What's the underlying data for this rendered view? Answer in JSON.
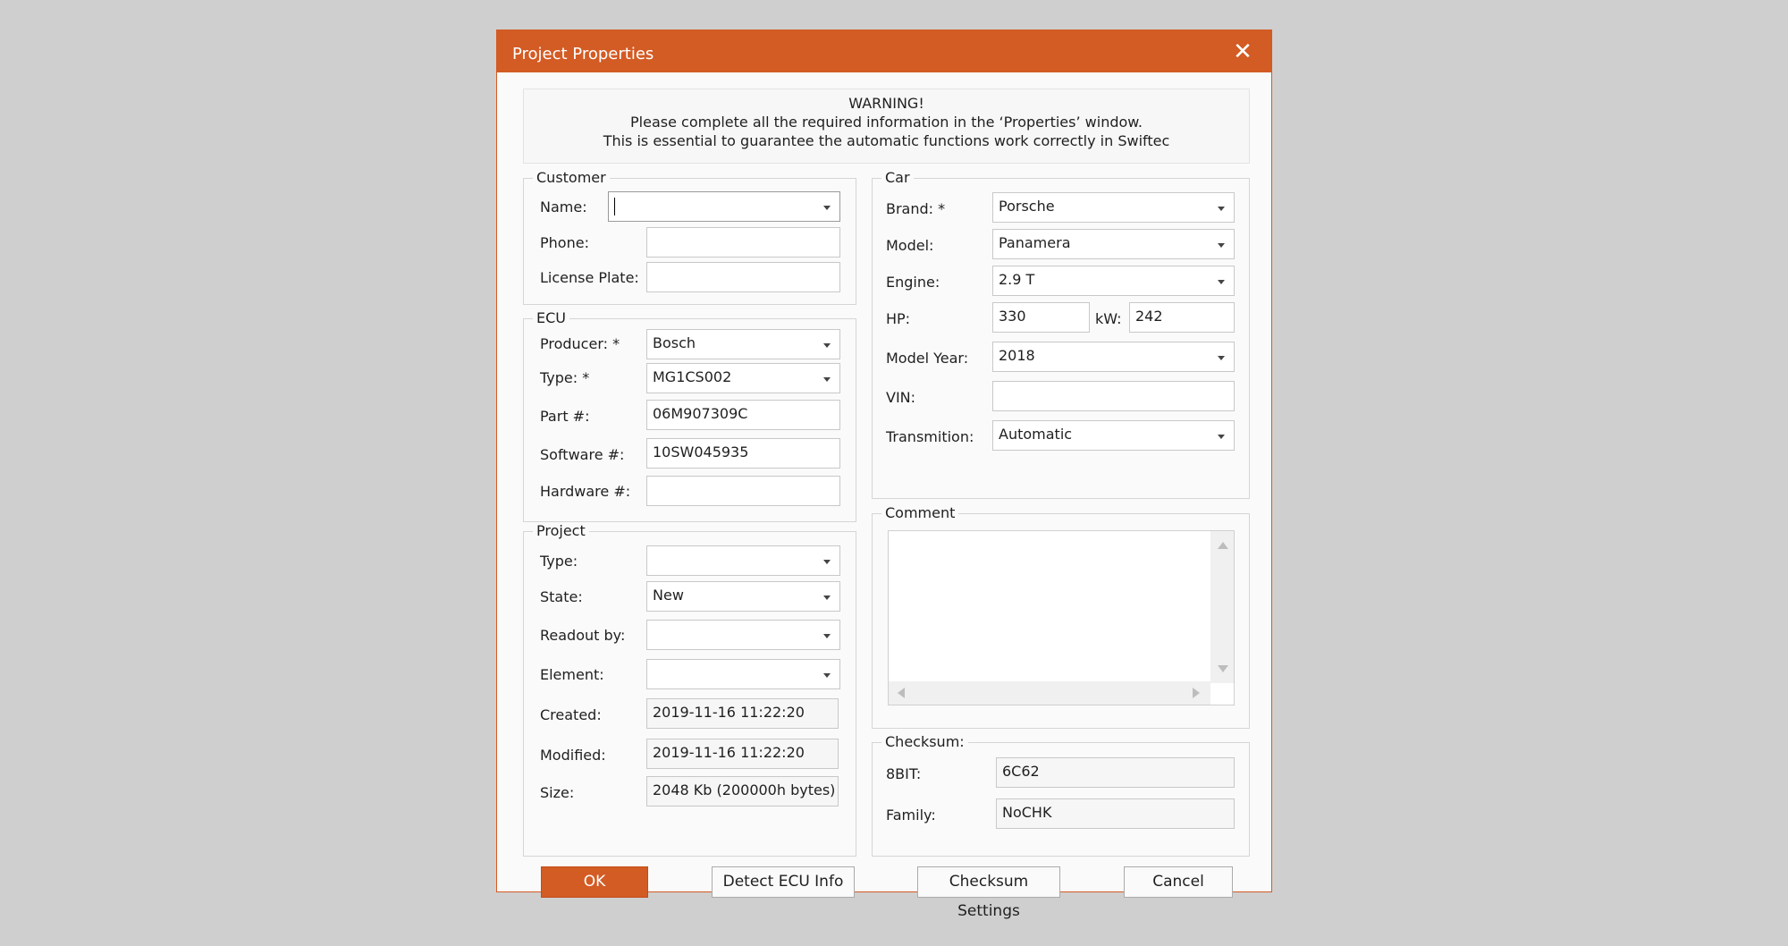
{
  "dialog": {
    "title": "Project Properties"
  },
  "warning": {
    "line1": "WARNING!",
    "line2": "Please complete all the required information in the ‘Properties’ window.",
    "line3": "This is essential to guarantee the automatic functions work correctly in Swiftec"
  },
  "customer": {
    "title": "Customer",
    "name_label": "Name:",
    "name_value": "",
    "phone_label": "Phone:",
    "phone_value": "",
    "plate_label": "License Plate:",
    "plate_value": ""
  },
  "ecu": {
    "title": "ECU",
    "producer_label": "Producer: *",
    "producer_value": "Bosch",
    "type_label": "Type: *",
    "type_value": "MG1CS002",
    "part_label": "Part #:",
    "part_value": "06M907309C",
    "software_label": "Software #:",
    "software_value": "10SW045935",
    "hardware_label": "Hardware #:",
    "hardware_value": ""
  },
  "project": {
    "title": "Project",
    "type_label": "Type:",
    "type_value": "",
    "state_label": "State:",
    "state_value": "New",
    "readout_label": "Readout by:",
    "readout_value": "",
    "element_label": "Element:",
    "element_value": "",
    "created_label": "Created:",
    "created_value": "2019-11-16 11:22:20",
    "modified_label": "Modified:",
    "modified_value": "2019-11-16 11:22:20",
    "size_label": "Size:",
    "size_value": "2048 Kb (200000h bytes)"
  },
  "car": {
    "title": "Car",
    "brand_label": "Brand: *",
    "brand_value": "Porsche",
    "model_label": "Model:",
    "model_value": "Panamera",
    "engine_label": "Engine:",
    "engine_value": "2.9 T",
    "hp_label": "HP:",
    "hp_value": "330",
    "kw_label": "kW:",
    "kw_value": "242",
    "year_label": "Model Year:",
    "year_value": "2018",
    "vin_label": "VIN:",
    "vin_value": "",
    "trans_label": "Transmition:",
    "trans_value": "Automatic"
  },
  "comment": {
    "title": "Comment",
    "value": ""
  },
  "checksum": {
    "title": "Checksum:",
    "bit_label": "8BIT:",
    "bit_value": "6C62",
    "family_label": "Family:",
    "family_value": "NoCHK"
  },
  "buttons": {
    "ok": "OK",
    "detect": "Detect ECU Info",
    "checksum_settings": "Checksum Settings",
    "cancel": "Cancel"
  },
  "colors": {
    "accent": "#d35b24",
    "background": "#cfcfcf"
  }
}
